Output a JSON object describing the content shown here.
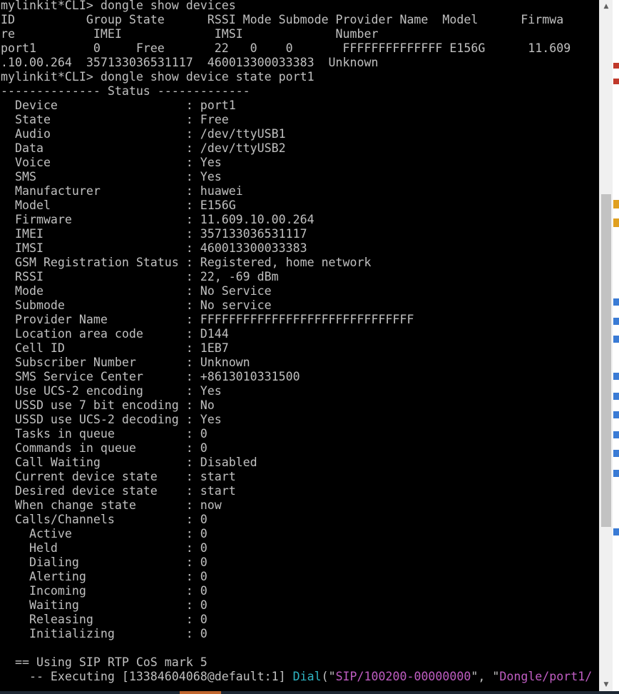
{
  "terminal": {
    "lines": [
      "mylinkit*CLI> dongle show devices",
      "ID          Group State      RSSI Mode Submode Provider Name  Model      Firmwa",
      "re           IMEI             IMSI             Number",
      "port1        0     Free       22   0    0       FFFFFFFFFFFFFF E156G      11.609",
      ".10.00.264  357133036531117  460013300033383  Unknown",
      "mylinkit*CLI> dongle show device state port1",
      "-------------- Status -------------",
      "  Device                  : port1",
      "  State                   : Free",
      "  Audio                   : /dev/ttyUSB1",
      "  Data                    : /dev/ttyUSB2",
      "  Voice                   : Yes",
      "  SMS                     : Yes",
      "  Manufacturer            : huawei",
      "  Model                   : E156G",
      "  Firmware                : 11.609.10.00.264",
      "  IMEI                    : 357133036531117",
      "  IMSI                    : 460013300033383",
      "  GSM Registration Status : Registered, home network",
      "  RSSI                    : 22, -69 dBm",
      "  Mode                    : No Service",
      "  Submode                 : No service",
      "  Provider Name           : FFFFFFFFFFFFFFFFFFFFFFFFFFFFFF",
      "  Location area code      : D144",
      "  Cell ID                 : 1EB7",
      "  Subscriber Number       : Unknown",
      "  SMS Service Center      : +8613010331500",
      "  Use UCS-2 encoding      : Yes",
      "  USSD use 7 bit encoding : No",
      "  USSD use UCS-2 decoding : Yes",
      "  Tasks in queue          : 0",
      "  Commands in queue       : 0",
      "  Call Waiting            : Disabled",
      "  Current device state    : start",
      "  Desired device state    : start",
      "  When change state       : now",
      "  Calls/Channels          : 0",
      "    Active                : 0",
      "    Held                  : 0",
      "    Dialing               : 0",
      "    Alerting              : 0",
      "    Incoming              : 0",
      "    Waiting               : 0",
      "    Releasing             : 0",
      "    Initializing          : 0",
      "",
      "  == Using SIP RTP CoS mark 5"
    ],
    "exec_line": {
      "prefix": "    -- Executing [13384604068@default:1] ",
      "app": "Dial",
      "open": "(\"",
      "arg1": "SIP/100200-00000000",
      "sep": "\", \"",
      "arg2": "Dongle/port1/"
    }
  },
  "scrollbar": {
    "up_icon": "▲",
    "down_icon": "▼"
  },
  "colors": {
    "background": "#000000",
    "text": "#c0c0c0",
    "highlight_cyan": "#2fb5c4",
    "highlight_magenta": "#c05dc3"
  }
}
